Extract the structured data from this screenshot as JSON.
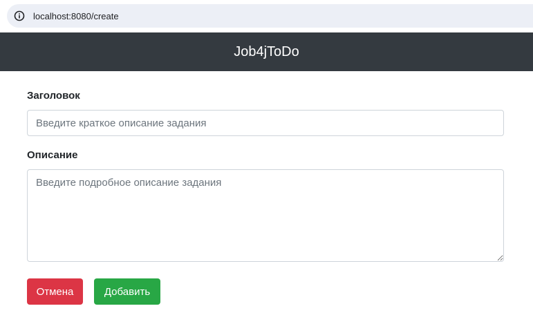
{
  "browser": {
    "url": "localhost:8080/create",
    "info_icon": "info-icon"
  },
  "navbar": {
    "brand": "Job4jToDo"
  },
  "form": {
    "title_label": "Заголовок",
    "title_placeholder": "Введите краткое описание задания",
    "title_value": "",
    "description_label": "Описание",
    "description_placeholder": "Введите подробное описание задания",
    "description_value": "",
    "cancel_label": "Отмена",
    "add_label": "Добавить"
  },
  "colors": {
    "navbar_bg": "#343a40",
    "cancel_bg": "#dc3545",
    "add_bg": "#28a745"
  }
}
